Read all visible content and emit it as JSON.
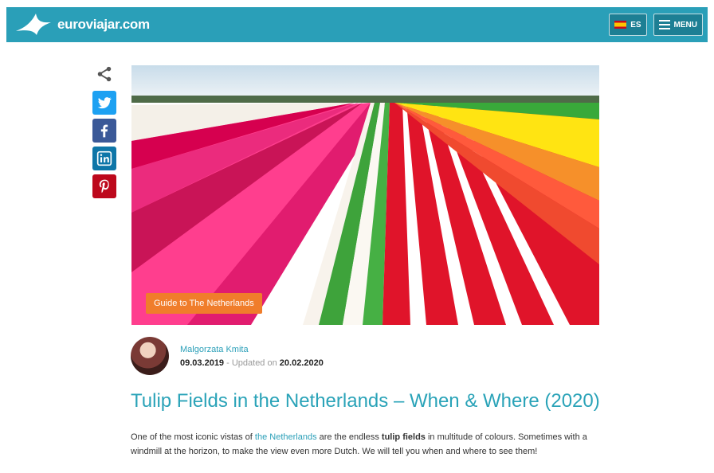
{
  "header": {
    "brand": "euroviajar.com",
    "lang_label": "ES",
    "menu_label": "MENU",
    "accent": "#2a9fb8"
  },
  "share": {
    "icons": [
      "share-icon",
      "twitter-icon",
      "facebook-icon",
      "linkedin-icon",
      "pinterest-icon"
    ]
  },
  "hero": {
    "tag": "Guide to The Netherlands"
  },
  "author": {
    "name": "Malgorzata Kmita",
    "published": "09.03.2019",
    "updated_prefix": " - Updated on ",
    "updated": "20.02.2020"
  },
  "article": {
    "title": "Tulip Fields in the Netherlands – When & Where (2020)",
    "intro_1": "One of the most iconic vistas of ",
    "intro_link": "the Netherlands",
    "intro_2": " are the endless ",
    "intro_bold": "tulip fields",
    "intro_3": " in multitude of colours. Sometimes with a windmill at the horizon, to make the view even more Dutch. We will tell you when and where to see them!"
  }
}
